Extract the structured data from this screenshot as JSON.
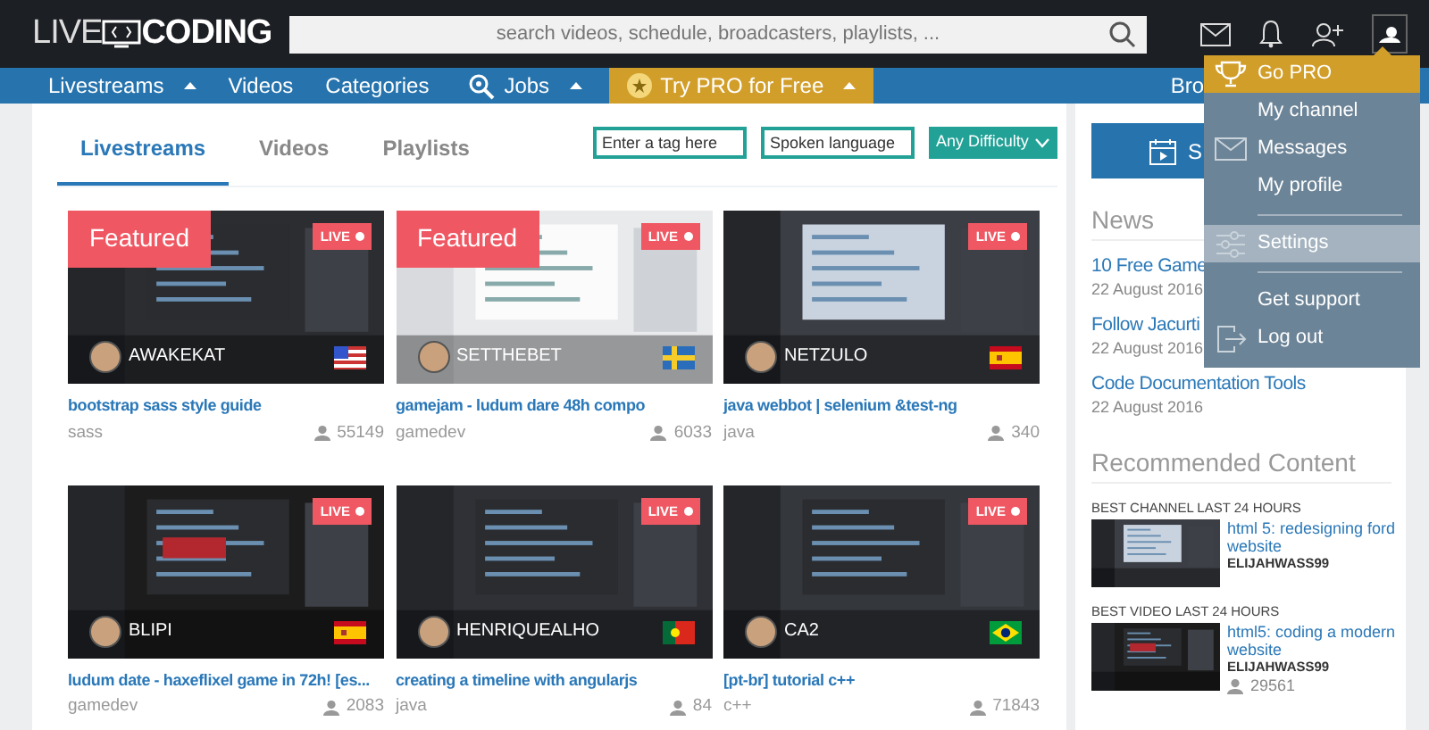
{
  "header": {
    "logo_left": "LIVE",
    "logo_right": "CODING",
    "search": {
      "placeholder": "search videos, schedule, broadcasters, playlists, ..."
    }
  },
  "nav": [
    {
      "label": "Livestreams",
      "kind": "menu"
    },
    {
      "label": "Videos",
      "kind": "link"
    },
    {
      "label": "Categories",
      "kind": "link"
    },
    {
      "label": "Jobs",
      "kind": "jobs"
    },
    {
      "label": "Try PRO for Free",
      "kind": "promo"
    },
    {
      "label": "Bro",
      "kind": "right"
    }
  ],
  "tabs": [
    {
      "label": "Livestreams",
      "selected": true
    },
    {
      "label": "Videos",
      "selected": false
    },
    {
      "label": "Playlists",
      "selected": false
    }
  ],
  "filters": {
    "tag": {
      "placeholder": "Enter a tag here"
    },
    "language": {
      "placeholder": "Spoken language"
    },
    "difficulty": "Any Difficulty"
  },
  "streams": [
    {
      "badge": "Featured",
      "live": "LIVE",
      "channel": "AWAKEKAT",
      "flag": {
        "kind": "us"
      },
      "title": "bootstrap sass style guide",
      "category": "sass",
      "viewers": "55149"
    },
    {
      "badge": "Featured",
      "live": "LIVE",
      "channel": "SETTHEBET",
      "flag": {
        "kind": "se"
      },
      "title": "gamejam - ludum dare 48h compo",
      "category": "gamedev",
      "viewers": "6033"
    },
    {
      "live": "LIVE",
      "channel": "NETZULO",
      "flag": {
        "kind": "es"
      },
      "title": "java webbot | selenium &test-ng",
      "category": "java",
      "viewers": "340"
    },
    {
      "live": "LIVE",
      "channel": "BLIPI",
      "flag": {
        "kind": "es"
      },
      "title": "ludum date - haxeflixel game in 72h! [es...",
      "category": "gamedev",
      "viewers": "2083"
    },
    {
      "live": "LIVE",
      "channel": "HENRIQUEALHO",
      "flag": {
        "kind": "pt"
      },
      "title": "creating a timeline with angularjs",
      "category": "java",
      "viewers": "84"
    },
    {
      "live": "LIVE",
      "channel": "CA2",
      "flag": {
        "kind": "br"
      },
      "title": "[pt-br] tutorial c++",
      "category": "c++",
      "viewers": "71843"
    }
  ],
  "sidebar": {
    "button": "S",
    "news_title": "News",
    "news": [
      {
        "title": "10 Free Game",
        "date": "22 August 2016"
      },
      {
        "title": "Follow Jacurti",
        "date": "22 August 2016"
      },
      {
        "title": "Code Documentation Tools",
        "date": "22 August 2016"
      }
    ],
    "recommended_title": "Recommended Content",
    "recommended": [
      {
        "heading": "BEST CHANNEL LAST 24 HOURS",
        "title": "html 5: redesigning ford website",
        "author": "ELIJAHWASS99"
      },
      {
        "heading": "BEST VIDEO LAST 24 HOURS",
        "title": "html5: coding a modern website",
        "author": "ELIJAHWASS99",
        "viewers": "29561"
      }
    ]
  },
  "user_menu": [
    {
      "label": "Go PRO",
      "kind": "promo",
      "selected": false
    },
    {
      "label": "My channel",
      "kind": "channel",
      "selected": false
    },
    {
      "label": "Messages",
      "kind": "messages",
      "selected": false
    },
    {
      "label": "My profile",
      "kind": "profile",
      "selected": false
    },
    {
      "label": "Settings",
      "kind": "settings",
      "selected": true
    },
    {
      "label": "Get support",
      "kind": "support",
      "selected": false
    },
    {
      "label": "Log out",
      "kind": "logout",
      "selected": false
    }
  ]
}
